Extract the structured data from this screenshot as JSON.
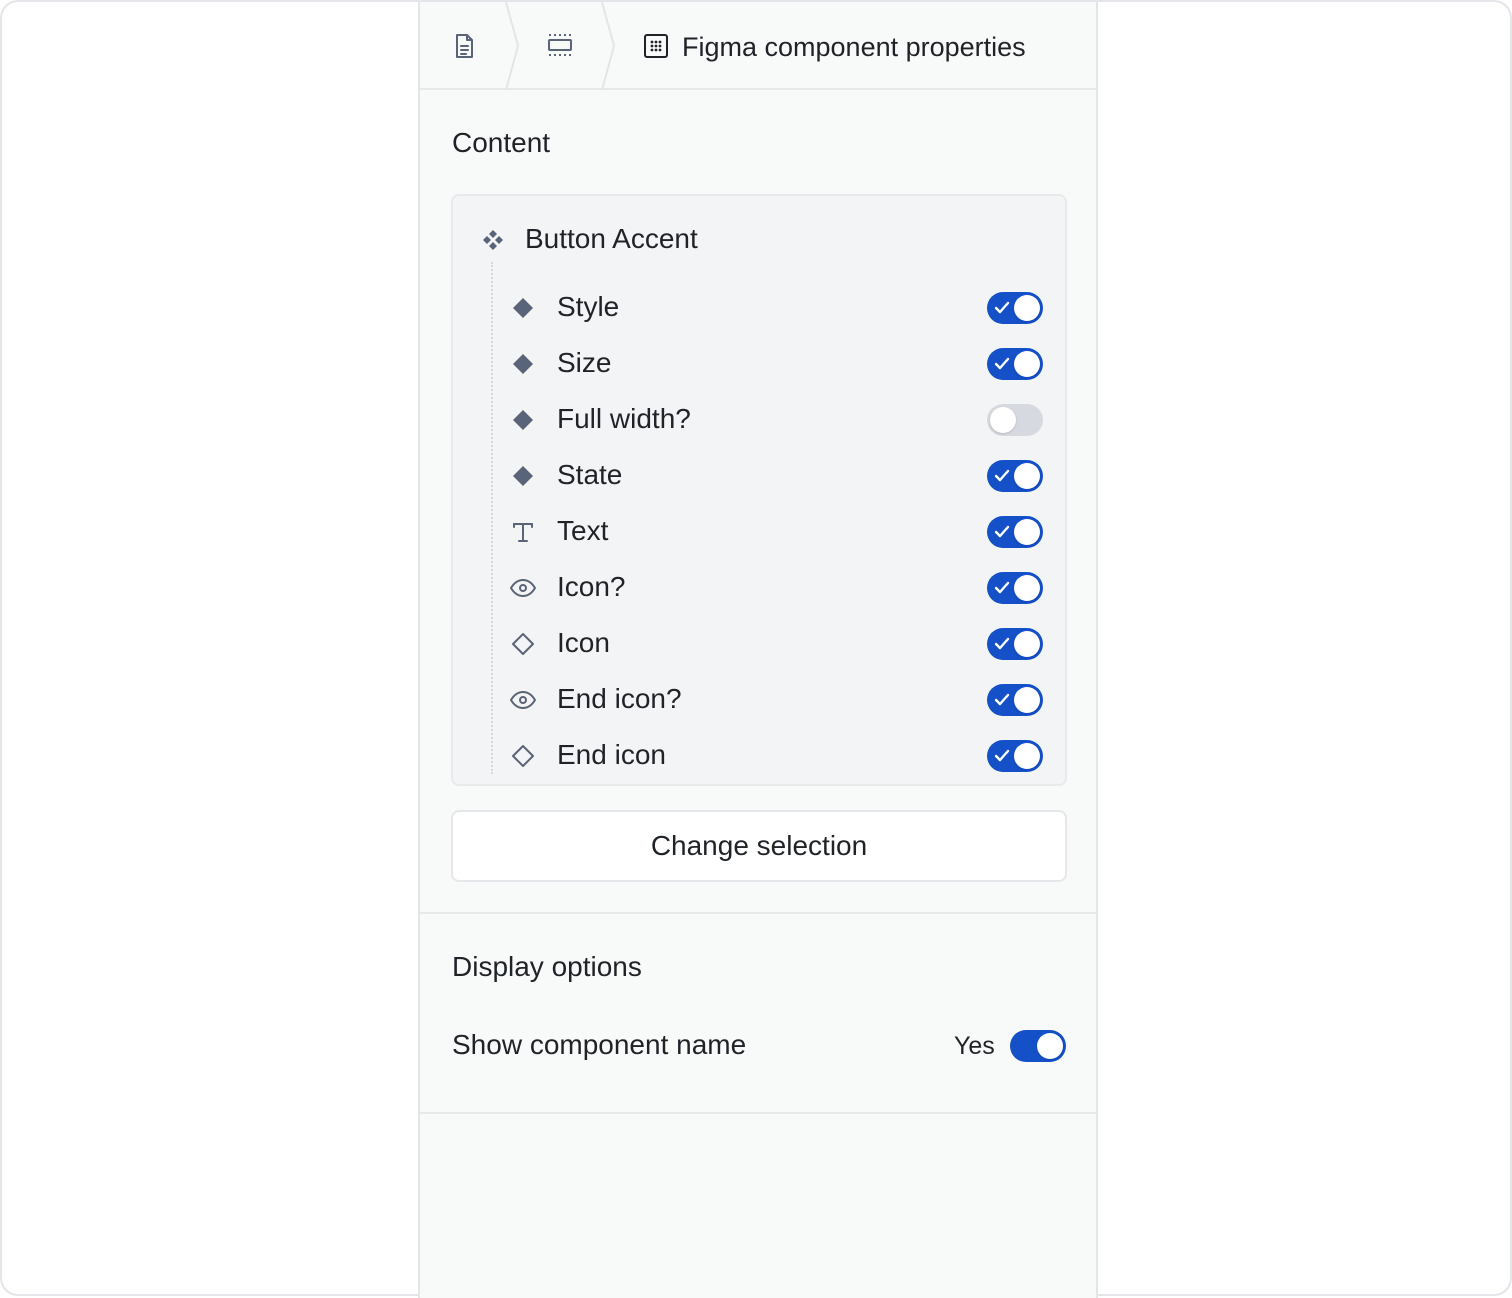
{
  "breadcrumb": {
    "items": [
      {
        "icon": "document-icon"
      },
      {
        "icon": "frame-icon"
      },
      {
        "icon": "component-set-icon",
        "label": "Figma component properties"
      }
    ]
  },
  "content": {
    "title": "Content",
    "component": {
      "icon": "component-icon",
      "name": "Button Accent",
      "properties": [
        {
          "label": "Style",
          "icon": "variant-diamond-icon",
          "enabled": true
        },
        {
          "label": "Size",
          "icon": "variant-diamond-icon",
          "enabled": true
        },
        {
          "label": "Full width?",
          "icon": "variant-diamond-icon",
          "enabled": false
        },
        {
          "label": "State",
          "icon": "variant-diamond-icon",
          "enabled": true
        },
        {
          "label": "Text",
          "icon": "text-icon",
          "enabled": true
        },
        {
          "label": "Icon?",
          "icon": "eye-icon",
          "enabled": true
        },
        {
          "label": "Icon",
          "icon": "instance-diamond-icon",
          "enabled": true
        },
        {
          "label": "End icon?",
          "icon": "eye-icon",
          "enabled": true
        },
        {
          "label": "End icon",
          "icon": "instance-diamond-icon",
          "enabled": true
        }
      ]
    },
    "change_selection_label": "Change selection"
  },
  "display_options": {
    "title": "Display options",
    "show_component_name": {
      "label": "Show component name",
      "value": "Yes",
      "enabled": true
    }
  },
  "colors": {
    "accent": "#1450c8",
    "toggle_off": "#d6d9df",
    "icon": "#5a6478",
    "panel_bg": "#f8f9f9"
  }
}
